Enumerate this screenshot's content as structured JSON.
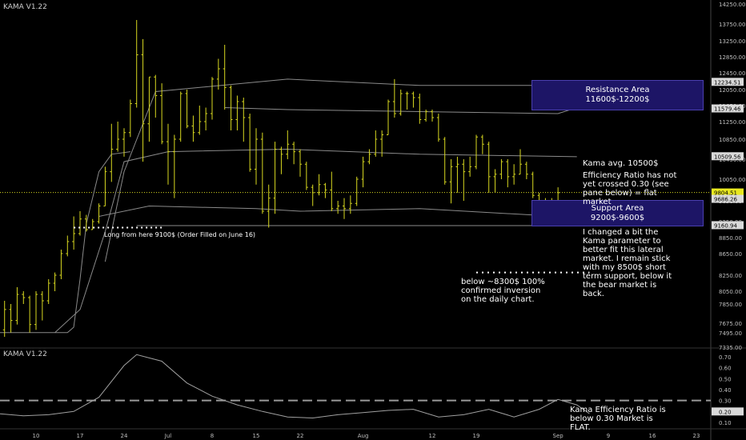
{
  "main_title": "KAMA V1.22",
  "sub_title": "KAMA V1.22",
  "colors": {
    "bars": "#d8d820",
    "bands": "#8a8a8a",
    "axis_text": "#bfbfbf",
    "grid_dot": "#d8d820",
    "box": "#1d1566",
    "er_line": "#a0a0a0",
    "er_dash": "#9a9a9a"
  },
  "annotations": {
    "resistance": {
      "line1": "Resistance Area",
      "line2": "11600$-12200$"
    },
    "support": {
      "line1": "Support Area",
      "line2": "9200$-9600$"
    },
    "kama_avg": "Kama avg. 10500$",
    "efficiency": "Efficiency Ratio has not yet crossed 0.30 (see pane below) = flat market",
    "changed": "I changed a bit the Kama parameter to better fit this lateral market. I remain stick with my 8500$ short term support, below it the bear market is back.",
    "below_8300": "below ~8300$ 100% confirmed inversion on the daily chart.",
    "long": "Long from here 9100$ (Order Filled on June 16)",
    "er_note": "Kama Efficiency Ratio is below 0.30 Market is FLAT."
  },
  "chart_data": [
    {
      "type": "ohlc",
      "y_ticks": [
        "14250.00",
        "13750.00",
        "13250.00",
        "12850.00",
        "12450.00",
        "12050.00",
        "11650.00",
        "11250.00",
        "10850.00",
        "10450.00",
        "10050.00",
        "9650.00",
        "9250.00",
        "8850.00",
        "8650.00",
        "8250.00",
        "8050.00",
        "7850.00",
        "7675.00",
        "7495.00",
        "7335.00"
      ],
      "price_labels": [
        {
          "text": "12234.51",
          "value": 12234.51
        },
        {
          "text": "11579.46",
          "value": 11579.46
        },
        {
          "text": "10509.56",
          "value": 10509.56
        },
        {
          "text": "9804.51",
          "value": 9804.51
        },
        {
          "text": "9686.26",
          "value": 9686.26
        },
        {
          "text": "9160.94",
          "value": 9160.94
        }
      ],
      "x_ticks": [
        "10",
        "17",
        "24",
        "Jul",
        "8",
        "15",
        "22",
        "Aug",
        "12",
        "19",
        "Sep",
        "9",
        "16",
        "23"
      ],
      "x_dates": [
        "2019-06-10",
        "2019-06-17",
        "2019-06-24",
        "2019-07-01",
        "2019-07-08",
        "2019-07-15",
        "2019-07-22",
        "2019-08-01",
        "2019-08-12",
        "2019-08-19",
        "2019-09-01",
        "2019-09-09",
        "2019-09-16",
        "2019-09-23"
      ],
      "ohlc": [
        [
          "2019-06-04",
          7680,
          7760,
          7500,
          7550
        ],
        [
          "2019-06-05",
          7550,
          7900,
          7450,
          7800
        ],
        [
          "2019-06-06",
          7800,
          7850,
          7500,
          7700
        ],
        [
          "2019-06-07",
          7700,
          8100,
          7650,
          8000
        ],
        [
          "2019-06-08",
          8000,
          8050,
          7850,
          7950
        ],
        [
          "2019-06-09",
          7950,
          7980,
          7500,
          7650
        ],
        [
          "2019-06-10",
          7650,
          8050,
          7550,
          8000
        ],
        [
          "2019-06-11",
          8000,
          8050,
          7700,
          7900
        ],
        [
          "2019-06-12",
          7900,
          8200,
          7850,
          8150
        ],
        [
          "2019-06-13",
          8150,
          8300,
          8050,
          8250
        ],
        [
          "2019-06-14",
          8250,
          8700,
          8200,
          8650
        ],
        [
          "2019-06-15",
          8650,
          8900,
          8600,
          8800
        ],
        [
          "2019-06-16",
          8800,
          9350,
          8700,
          8950
        ],
        [
          "2019-06-17",
          8950,
          9450,
          8900,
          9300
        ],
        [
          "2019-06-18",
          9300,
          9380,
          9000,
          9050
        ],
        [
          "2019-06-19",
          9050,
          9300,
          9050,
          9250
        ],
        [
          "2019-06-20",
          9250,
          9600,
          9200,
          9550
        ],
        [
          "2019-06-21",
          9550,
          10300,
          9550,
          10200
        ],
        [
          "2019-06-22",
          10200,
          11200,
          10000,
          10650
        ],
        [
          "2019-06-23",
          10650,
          11250,
          10600,
          10850
        ],
        [
          "2019-06-24",
          10850,
          11100,
          10500,
          11000
        ],
        [
          "2019-06-25",
          11000,
          11800,
          10900,
          11700
        ],
        [
          "2019-06-26",
          11700,
          13850,
          11600,
          12900
        ],
        [
          "2019-06-27",
          12900,
          13300,
          10400,
          11200
        ],
        [
          "2019-06-28",
          11200,
          12350,
          10800,
          12350
        ],
        [
          "2019-06-29",
          12350,
          12400,
          11350,
          11900
        ],
        [
          "2019-06-30",
          11900,
          12200,
          10750,
          10800
        ],
        [
          "2019-07-01",
          10800,
          11200,
          9950,
          10600
        ],
        [
          "2019-07-02",
          10600,
          10950,
          9700,
          10850
        ],
        [
          "2019-07-03",
          10850,
          12000,
          10800,
          11950
        ],
        [
          "2019-07-04",
          11950,
          12050,
          11100,
          11150
        ],
        [
          "2019-07-05",
          11150,
          11400,
          10800,
          11000
        ],
        [
          "2019-07-06",
          11000,
          11650,
          10950,
          11250
        ],
        [
          "2019-07-07",
          11250,
          11600,
          11050,
          11450
        ],
        [
          "2019-07-08",
          11450,
          12350,
          11300,
          12300
        ],
        [
          "2019-07-09",
          12300,
          12800,
          12050,
          12550
        ],
        [
          "2019-07-10",
          12550,
          13150,
          11550,
          12100
        ],
        [
          "2019-07-11",
          12100,
          12150,
          11050,
          11300
        ],
        [
          "2019-07-12",
          11300,
          11900,
          11050,
          11750
        ],
        [
          "2019-07-13",
          11750,
          11850,
          10800,
          11350
        ],
        [
          "2019-07-14",
          11350,
          11450,
          10200,
          10250
        ],
        [
          "2019-07-15",
          10250,
          11100,
          9950,
          10850
        ],
        [
          "2019-07-16",
          10850,
          11000,
          9400,
          9450
        ],
        [
          "2019-07-17",
          9450,
          9950,
          9100,
          9700
        ],
        [
          "2019-07-18",
          9700,
          10800,
          9400,
          10650
        ],
        [
          "2019-07-19",
          10650,
          10700,
          10150,
          10550
        ],
        [
          "2019-07-20",
          10550,
          11050,
          10450,
          10750
        ],
        [
          "2019-07-21",
          10750,
          10800,
          10350,
          10600
        ],
        [
          "2019-07-22",
          10600,
          10650,
          10100,
          10350
        ],
        [
          "2019-07-23",
          10350,
          10400,
          9850,
          9900
        ],
        [
          "2019-07-24",
          9900,
          9950,
          9550,
          9800
        ],
        [
          "2019-07-25",
          9800,
          10150,
          9750,
          9950
        ],
        [
          "2019-07-26",
          9950,
          9980,
          9700,
          9850
        ],
        [
          "2019-07-27",
          9850,
          10200,
          9450,
          9500
        ],
        [
          "2019-07-28",
          9500,
          9650,
          9400,
          9550
        ],
        [
          "2019-07-29",
          9550,
          9700,
          9300,
          9500
        ],
        [
          "2019-07-30",
          9500,
          9750,
          9400,
          9600
        ],
        [
          "2019-07-31",
          9600,
          10100,
          9550,
          10050
        ],
        [
          "2019-08-01",
          10050,
          10500,
          9900,
          10400
        ],
        [
          "2019-08-02",
          10400,
          10650,
          10350,
          10550
        ],
        [
          "2019-08-03",
          10550,
          11050,
          10500,
          10850
        ],
        [
          "2019-08-04",
          10850,
          11050,
          10500,
          10950
        ],
        [
          "2019-08-05",
          10950,
          11800,
          10950,
          11750
        ],
        [
          "2019-08-06",
          11750,
          12300,
          11350,
          11450
        ],
        [
          "2019-08-07",
          11450,
          12050,
          11400,
          11950
        ],
        [
          "2019-08-08",
          11950,
          12000,
          11550,
          11950
        ],
        [
          "2019-08-09",
          11950,
          12000,
          11600,
          11850
        ],
        [
          "2019-08-10",
          11850,
          11950,
          11200,
          11300
        ],
        [
          "2019-08-11",
          11300,
          11550,
          11250,
          11500
        ],
        [
          "2019-08-12",
          11500,
          11550,
          11250,
          11350
        ],
        [
          "2019-08-13",
          11350,
          11450,
          10800,
          10850
        ],
        [
          "2019-08-14",
          10850,
          10900,
          9950,
          10000
        ],
        [
          "2019-08-15",
          10000,
          10450,
          9600,
          10300
        ],
        [
          "2019-08-16",
          10300,
          10500,
          9800,
          10350
        ],
        [
          "2019-08-17",
          10350,
          10450,
          9650,
          10200
        ],
        [
          "2019-08-18",
          10200,
          10500,
          10100,
          10300
        ],
        [
          "2019-08-19",
          10300,
          10950,
          10250,
          10900
        ],
        [
          "2019-08-20",
          10900,
          10950,
          10550,
          10750
        ],
        [
          "2019-08-21",
          10750,
          10800,
          9800,
          10100
        ],
        [
          "2019-08-22",
          10100,
          10250,
          9800,
          10150
        ],
        [
          "2019-08-23",
          10150,
          10450,
          10050,
          10400
        ],
        [
          "2019-08-24",
          10400,
          10450,
          9900,
          10100
        ],
        [
          "2019-08-25",
          10100,
          10350,
          9950,
          10150
        ],
        [
          "2019-08-26",
          10150,
          10650,
          10150,
          10350
        ],
        [
          "2019-08-27",
          10350,
          10400,
          10050,
          10150
        ],
        [
          "2019-08-28",
          10150,
          10200,
          9700,
          9750
        ],
        [
          "2019-08-29",
          9750,
          9800,
          9350,
          9500
        ],
        [
          "2019-08-30",
          9500,
          9700,
          9400,
          9600
        ],
        [
          "2019-08-31",
          9600,
          9700,
          9450,
          9650
        ],
        [
          "2019-09-01",
          9650,
          9900,
          9550,
          9800
        ]
      ],
      "kama_upper": [
        [
          8500,
          "2019-06-21"
        ],
        [
          10200,
          "2019-06-24"
        ],
        [
          12000,
          "2019-06-29"
        ],
        [
          12300,
          "2019-07-20"
        ],
        [
          12150,
          "2019-08-10"
        ],
        [
          12150,
          "2019-09-01"
        ],
        [
          12050,
          "2019-09-04"
        ]
      ],
      "kama_mid_upper": [
        [
          11600,
          "2019-07-10"
        ],
        [
          11550,
          "2019-07-20"
        ],
        [
          11500,
          "2019-08-10"
        ],
        [
          11450,
          "2019-09-01"
        ],
        [
          11600,
          "2019-09-04"
        ]
      ],
      "kama_mid": [
        [
          7500,
          "2019-06-13"
        ],
        [
          7800,
          "2019-06-17"
        ],
        [
          9000,
          "2019-06-21"
        ],
        [
          10400,
          "2019-06-24"
        ],
        [
          10600,
          "2019-07-01"
        ],
        [
          10650,
          "2019-07-20"
        ],
        [
          10550,
          "2019-08-10"
        ],
        [
          10500,
          "2019-09-04"
        ]
      ],
      "kama_lower": [
        [
          9350,
          "2019-06-20"
        ],
        [
          9550,
          "2019-06-28"
        ],
        [
          9500,
          "2019-07-15"
        ],
        [
          9450,
          "2019-07-22"
        ],
        [
          9500,
          "2019-08-10"
        ],
        [
          9350,
          "2019-09-01"
        ],
        [
          9300,
          "2019-09-04"
        ]
      ],
      "kama_bottom": [
        [
          9150,
          "2019-06-26"
        ],
        [
          9150,
          "2019-07-22"
        ],
        [
          9150,
          "2019-08-10"
        ],
        [
          9150,
          "2019-09-04"
        ]
      ],
      "kama_slow": [
        [
          7500,
          "2019-06-04"
        ],
        [
          7500,
          "2019-06-15"
        ],
        [
          7600,
          "2019-06-16"
        ],
        [
          8200,
          "2019-06-17"
        ],
        [
          9200,
          "2019-06-18"
        ],
        [
          10200,
          "2019-06-20"
        ],
        [
          10550,
          "2019-06-22"
        ],
        [
          10600,
          "2019-06-25"
        ]
      ],
      "reference_line": 9804.51,
      "long_entry": 9100,
      "short_support": 8300
    },
    {
      "type": "line",
      "name": "KAMA V1.22",
      "y_ticks": [
        "0.70",
        "0.60",
        "0.50",
        "0.40",
        "0.30",
        "0.20",
        "0.10"
      ],
      "last_value_label": "0.20",
      "threshold": 0.3,
      "series_x": [
        "2019-06-04",
        "2019-06-08",
        "2019-06-12",
        "2019-06-16",
        "2019-06-20",
        "2019-06-24",
        "2019-06-26",
        "2019-06-30",
        "2019-07-04",
        "2019-07-08",
        "2019-07-12",
        "2019-07-16",
        "2019-07-20",
        "2019-07-24",
        "2019-07-28",
        "2019-08-01",
        "2019-08-05",
        "2019-08-09",
        "2019-08-13",
        "2019-08-17",
        "2019-08-21",
        "2019-08-25",
        "2019-08-29",
        "2019-09-01",
        "2019-09-04",
        "2019-09-06"
      ],
      "series_y": [
        0.18,
        0.16,
        0.17,
        0.2,
        0.33,
        0.62,
        0.72,
        0.66,
        0.46,
        0.34,
        0.26,
        0.2,
        0.15,
        0.14,
        0.17,
        0.19,
        0.21,
        0.22,
        0.15,
        0.17,
        0.22,
        0.15,
        0.22,
        0.31,
        0.26,
        0.18
      ]
    }
  ]
}
